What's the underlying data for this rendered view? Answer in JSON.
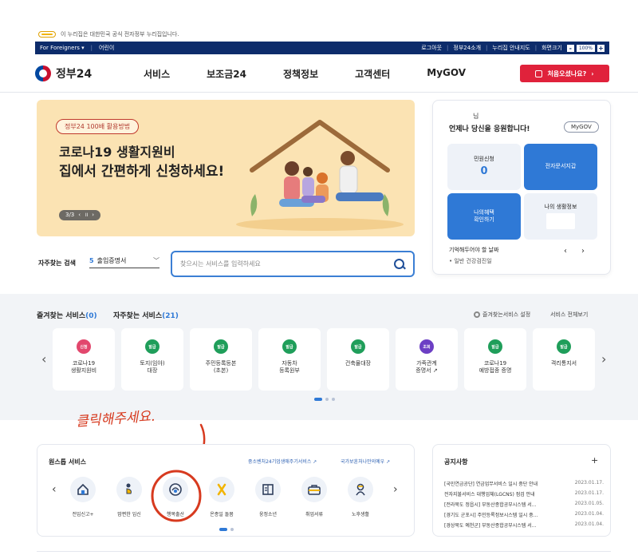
{
  "gov_banner": {
    "text": "이 누리집은 대한민국 공식 전자정부 누리집입니다."
  },
  "topbar": {
    "foreigners": "For Foreigners ▾",
    "kids": "어린이",
    "logout": "로그아웃",
    "intro": "정부24소개",
    "guide": "누리집 안내지도",
    "zoom_label": "화면크기",
    "zoom_value": "100%",
    "zoom_minus": "-",
    "zoom_plus": "+"
  },
  "header": {
    "logo_text": "정부24",
    "nav": [
      "서비스",
      "보조금24",
      "정책정보",
      "고객센터",
      "MyGOV"
    ],
    "first_visit_btn": "처음오셨나요?"
  },
  "hero": {
    "tag": "정부24 100배 활용방법",
    "title1": "코로나19 생활지원비",
    "title2": "집에서 간편하게 신청하세요!",
    "pager": "3/3",
    "pager_prev": "‹",
    "pager_pause": "॥",
    "pager_next": "›"
  },
  "side_card": {
    "nim": "님",
    "cheer": "언제나 당신을 응원합니다!",
    "mygov_btn": "MyGOV",
    "tile_civil_label": "민원신청",
    "tile_civil_count": "0",
    "tile_doc": "전자문서지갑",
    "tile_benefit": "나의혜택\n확인하기",
    "tile_life": "나의 생활정보",
    "remember": "기억해두어야 할 날짜",
    "checkup": "• 일반 건강검진일",
    "prev": "‹",
    "next": "›"
  },
  "search": {
    "label": "자주찾는 검색",
    "rank": "5",
    "selected": "출입증명서",
    "chevron": "﹀",
    "placeholder": "찾으시는 서비스를 입력하세요"
  },
  "services": {
    "fav_label": "즐겨찾는 서비스",
    "fav_count": "(0)",
    "freq_label": "자주찾는 서비스",
    "freq_count": "(21)",
    "setting": "즐겨찾는서비스 설정",
    "all": "서비스 전체보기",
    "prev": "‹",
    "next": "›",
    "items": [
      {
        "badge": "신청",
        "color": "#e2476d",
        "name": "코로나19\n생활지원비"
      },
      {
        "badge": "발급",
        "color": "#1f9e5a",
        "name": "토지(임야)\n대장"
      },
      {
        "badge": "발급",
        "color": "#1f9e5a",
        "name": "주민등록등본\n(초본)"
      },
      {
        "badge": "발급",
        "color": "#1f9e5a",
        "name": "자동차\n등록원부"
      },
      {
        "badge": "발급",
        "color": "#1f9e5a",
        "name": "건축물대장"
      },
      {
        "badge": "조회",
        "color": "#6c3fc4",
        "name": "가족관계\n증명서 ↗"
      },
      {
        "badge": "발급",
        "color": "#1f9e5a",
        "name": "코로나19\n예방접종 증명"
      },
      {
        "badge": "발급",
        "color": "#1f9e5a",
        "name": "격리통지서"
      }
    ]
  },
  "note": {
    "text": "클릭해주세요."
  },
  "onestop": {
    "title": "원스톱 서비스",
    "link1": "중소벤처24기업생애주기서비스 ↗",
    "link2": "국가보훈처나만의예우 ↗",
    "prev": "‹",
    "next": "›",
    "items": [
      {
        "label": "전입신고+",
        "icon": "house-icon"
      },
      {
        "label": "맘편한 임신",
        "icon": "pregnant-icon"
      },
      {
        "label": "행복출산",
        "icon": "baby-icon"
      },
      {
        "label": "온종일 돌봄",
        "icon": "ribbon-icon"
      },
      {
        "label": "웅정소년",
        "icon": "book-icon"
      },
      {
        "label": "취업서류",
        "icon": "briefcase-icon"
      },
      {
        "label": "노후생활",
        "icon": "elder-icon"
      }
    ]
  },
  "notice": {
    "title": "공지사항",
    "plus": "+",
    "rows": [
      {
        "text": "[국민연금공단] 연금업무서비스 일시 중단 안내",
        "date": "2023.01.17."
      },
      {
        "text": "전자지불서비스 대행업체(LGCNS) 점검 안내",
        "date": "2023.01.17."
      },
      {
        "text": "[전라북도 정읍시] 부동산종합공부시스템 서...",
        "date": "2023.01.05."
      },
      {
        "text": "[경기도 군포시] 주민등록정보시스템 일시 중...",
        "date": "2023.01.04."
      },
      {
        "text": "[경상북도 예천군] 부동산종합공부시스템 서...",
        "date": "2023.01.04."
      }
    ]
  }
}
